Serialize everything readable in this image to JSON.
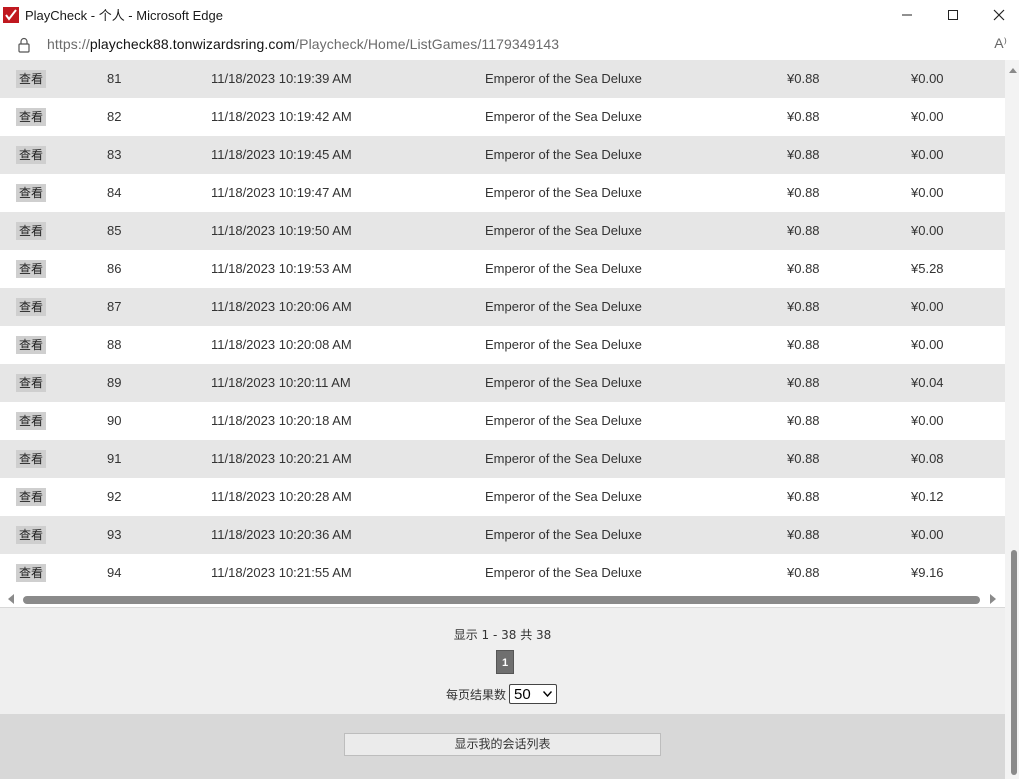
{
  "window": {
    "title": "PlayCheck - 个人 - Microsoft Edge",
    "controls": [
      "minimize-icon",
      "maximize-icon",
      "close-icon"
    ]
  },
  "address_bar": {
    "protocol": "https://",
    "host": "playcheck88.tonwizardsring.com",
    "path": "/Playcheck/Home/ListGames/1179349143",
    "read_aloud": "A⁾"
  },
  "table": {
    "view_label": "查看",
    "rows": [
      {
        "num": "81",
        "time": "11/18/2023 10:19:39 AM",
        "game": "Emperor of the Sea Deluxe",
        "bet": "¥0.88",
        "win": "¥0.00"
      },
      {
        "num": "82",
        "time": "11/18/2023 10:19:42 AM",
        "game": "Emperor of the Sea Deluxe",
        "bet": "¥0.88",
        "win": "¥0.00"
      },
      {
        "num": "83",
        "time": "11/18/2023 10:19:45 AM",
        "game": "Emperor of the Sea Deluxe",
        "bet": "¥0.88",
        "win": "¥0.00"
      },
      {
        "num": "84",
        "time": "11/18/2023 10:19:47 AM",
        "game": "Emperor of the Sea Deluxe",
        "bet": "¥0.88",
        "win": "¥0.00"
      },
      {
        "num": "85",
        "time": "11/18/2023 10:19:50 AM",
        "game": "Emperor of the Sea Deluxe",
        "bet": "¥0.88",
        "win": "¥0.00"
      },
      {
        "num": "86",
        "time": "11/18/2023 10:19:53 AM",
        "game": "Emperor of the Sea Deluxe",
        "bet": "¥0.88",
        "win": "¥5.28"
      },
      {
        "num": "87",
        "time": "11/18/2023 10:20:06 AM",
        "game": "Emperor of the Sea Deluxe",
        "bet": "¥0.88",
        "win": "¥0.00"
      },
      {
        "num": "88",
        "time": "11/18/2023 10:20:08 AM",
        "game": "Emperor of the Sea Deluxe",
        "bet": "¥0.88",
        "win": "¥0.00"
      },
      {
        "num": "89",
        "time": "11/18/2023 10:20:11 AM",
        "game": "Emperor of the Sea Deluxe",
        "bet": "¥0.88",
        "win": "¥0.04"
      },
      {
        "num": "90",
        "time": "11/18/2023 10:20:18 AM",
        "game": "Emperor of the Sea Deluxe",
        "bet": "¥0.88",
        "win": "¥0.00"
      },
      {
        "num": "91",
        "time": "11/18/2023 10:20:21 AM",
        "game": "Emperor of the Sea Deluxe",
        "bet": "¥0.88",
        "win": "¥0.08"
      },
      {
        "num": "92",
        "time": "11/18/2023 10:20:28 AM",
        "game": "Emperor of the Sea Deluxe",
        "bet": "¥0.88",
        "win": "¥0.12"
      },
      {
        "num": "93",
        "time": "11/18/2023 10:20:36 AM",
        "game": "Emperor of the Sea Deluxe",
        "bet": "¥0.88",
        "win": "¥0.00"
      },
      {
        "num": "94",
        "time": "11/18/2023 10:21:55 AM",
        "game": "Emperor of the Sea Deluxe",
        "bet": "¥0.88",
        "win": "¥9.16"
      }
    ]
  },
  "pager": {
    "info": "显示 1 - 38 共 38",
    "current_page": "1",
    "per_page_label": "每页结果数",
    "per_page_value": "50"
  },
  "footer": {
    "session_button": "显示我的会话列表"
  },
  "colors": {
    "row_shade": "#e6e6e6",
    "pager_bg": "#efefef",
    "footer_bg": "#d8d8d8",
    "page_button": "#6f6f6f"
  }
}
